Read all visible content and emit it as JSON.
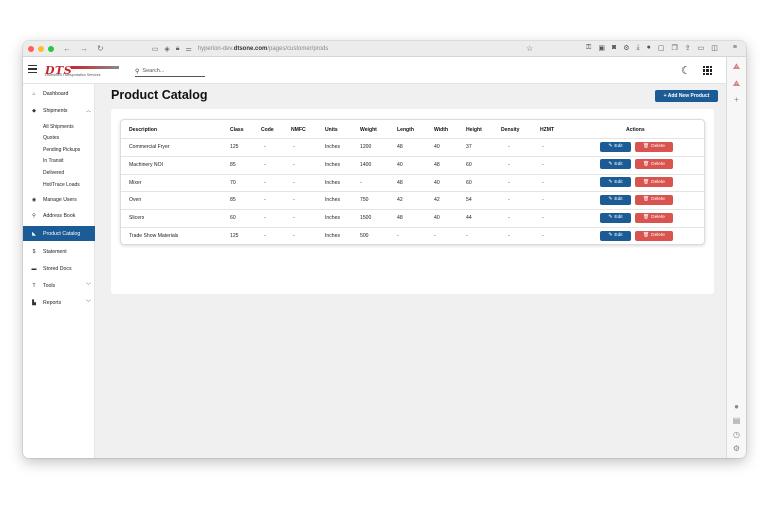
{
  "browser": {
    "url_prefix": "hyperion-dev.",
    "url_domain": "dtsone.com",
    "url_path": "/pages/customer/prods",
    "icons": [
      "sidebar-icon",
      "shield-icon",
      "lock-icon",
      "tune-icon"
    ],
    "colors": {
      "close": "#ff5f57",
      "minimize": "#febc2e",
      "maximize": "#28c840"
    }
  },
  "header": {
    "logo_text": "DTS",
    "logo_tagline": "Diversified Transportation Services",
    "search_placeholder": "Search..."
  },
  "sidebar": {
    "items": [
      {
        "label": "Dashboard",
        "icon": "home-icon"
      },
      {
        "label": "Shipments",
        "icon": "box-icon",
        "expanded": true
      },
      {
        "label": "Manage Users",
        "icon": "eye-icon"
      },
      {
        "label": "Address Book",
        "icon": "pin-icon"
      },
      {
        "label": "Product Catalog",
        "icon": "tag-icon",
        "active": true
      },
      {
        "label": "Statement",
        "icon": "dollar-icon"
      },
      {
        "label": "Stored Docs",
        "icon": "folder-icon"
      },
      {
        "label": "Tools",
        "icon": "hammer-icon"
      },
      {
        "label": "Reports",
        "icon": "chart-icon"
      }
    ],
    "shipment_subitems": [
      "All Shipments",
      "Quotes",
      "Pending Pickups",
      "In Transit",
      "Delivered",
      "Hot/Trace Loads"
    ]
  },
  "page": {
    "title": "Product Catalog",
    "add_button": "+ Add New Product"
  },
  "table": {
    "headers": [
      "Description",
      "Class",
      "Code",
      "NMFC",
      "Units",
      "Weight",
      "Length",
      "Width",
      "Height",
      "Density",
      "HZMT",
      "Actions"
    ],
    "rows": [
      [
        "Commercial Fryer",
        "125",
        "-",
        "-",
        "Inches",
        "1200",
        "48",
        "40",
        "37",
        "-",
        "-"
      ],
      [
        "Machinery NOI",
        "85",
        "-",
        "-",
        "Inches",
        "1400",
        "40",
        "48",
        "60",
        "-",
        "-"
      ],
      [
        "Mixer",
        "70",
        "-",
        "-",
        "Inches",
        "-",
        "48",
        "40",
        "60",
        "-",
        "-"
      ],
      [
        "Oven",
        "85",
        "-",
        "-",
        "Inches",
        "750",
        "42",
        "42",
        "54",
        "-",
        "-"
      ],
      [
        "Slicers",
        "60",
        "-",
        "-",
        "Inches",
        "1500",
        "48",
        "40",
        "44",
        "-",
        "-"
      ],
      [
        "Trade Show Materials",
        "125",
        "-",
        "-",
        "Inches",
        "500",
        "-",
        "-",
        "-",
        "-",
        "-"
      ]
    ],
    "edit_label": "Edit",
    "delete_label": "Delete"
  },
  "colors": {
    "primary": "#1c5c96",
    "danger": "#d9534f",
    "brand": "#c8262d"
  }
}
